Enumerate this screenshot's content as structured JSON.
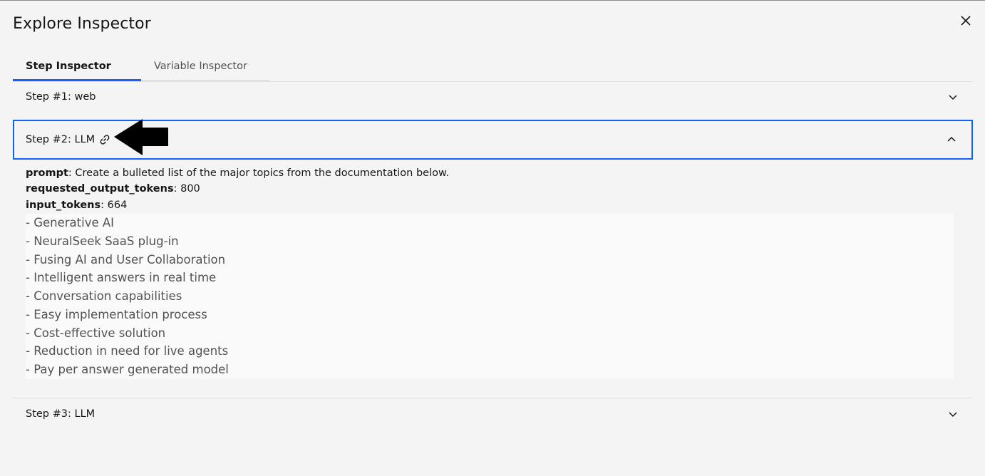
{
  "modal": {
    "title": "Explore Inspector"
  },
  "tabs": [
    {
      "label": "Step Inspector",
      "active": true
    },
    {
      "label": "Variable Inspector",
      "active": false
    }
  ],
  "steps": [
    {
      "label": "Step #1: web",
      "expanded": false
    },
    {
      "label": "Step #2: LLM",
      "expanded": true
    },
    {
      "label": "Step #3: LLM",
      "expanded": false
    }
  ],
  "step2": {
    "prompt_key": "prompt",
    "prompt_value": ": Create a bulleted list of the major topics from the documentation below.",
    "output_tokens_key": "requested_output_tokens",
    "output_tokens_value": ": 800",
    "input_tokens_key": "input_tokens",
    "input_tokens_value": ": 664",
    "output_lines": [
      "- Generative AI",
      "- NeuralSeek SaaS plug-in",
      "- Fusing AI and User Collaboration",
      "- Intelligent answers in real time",
      "- Conversation capabilities",
      "- Easy implementation process",
      "- Cost-effective solution",
      "- Reduction in need for live agents",
      "- Pay per answer generated model"
    ]
  },
  "icons": {
    "close": "close-icon",
    "chevron_down": "chevron-down-icon",
    "chevron_up": "chevron-up-icon",
    "link": "link-icon",
    "arrow": "arrow-left-icon"
  },
  "colors": {
    "accent": "#0f62fe",
    "background": "#f4f4f4",
    "output_bg": "#fafafa"
  }
}
